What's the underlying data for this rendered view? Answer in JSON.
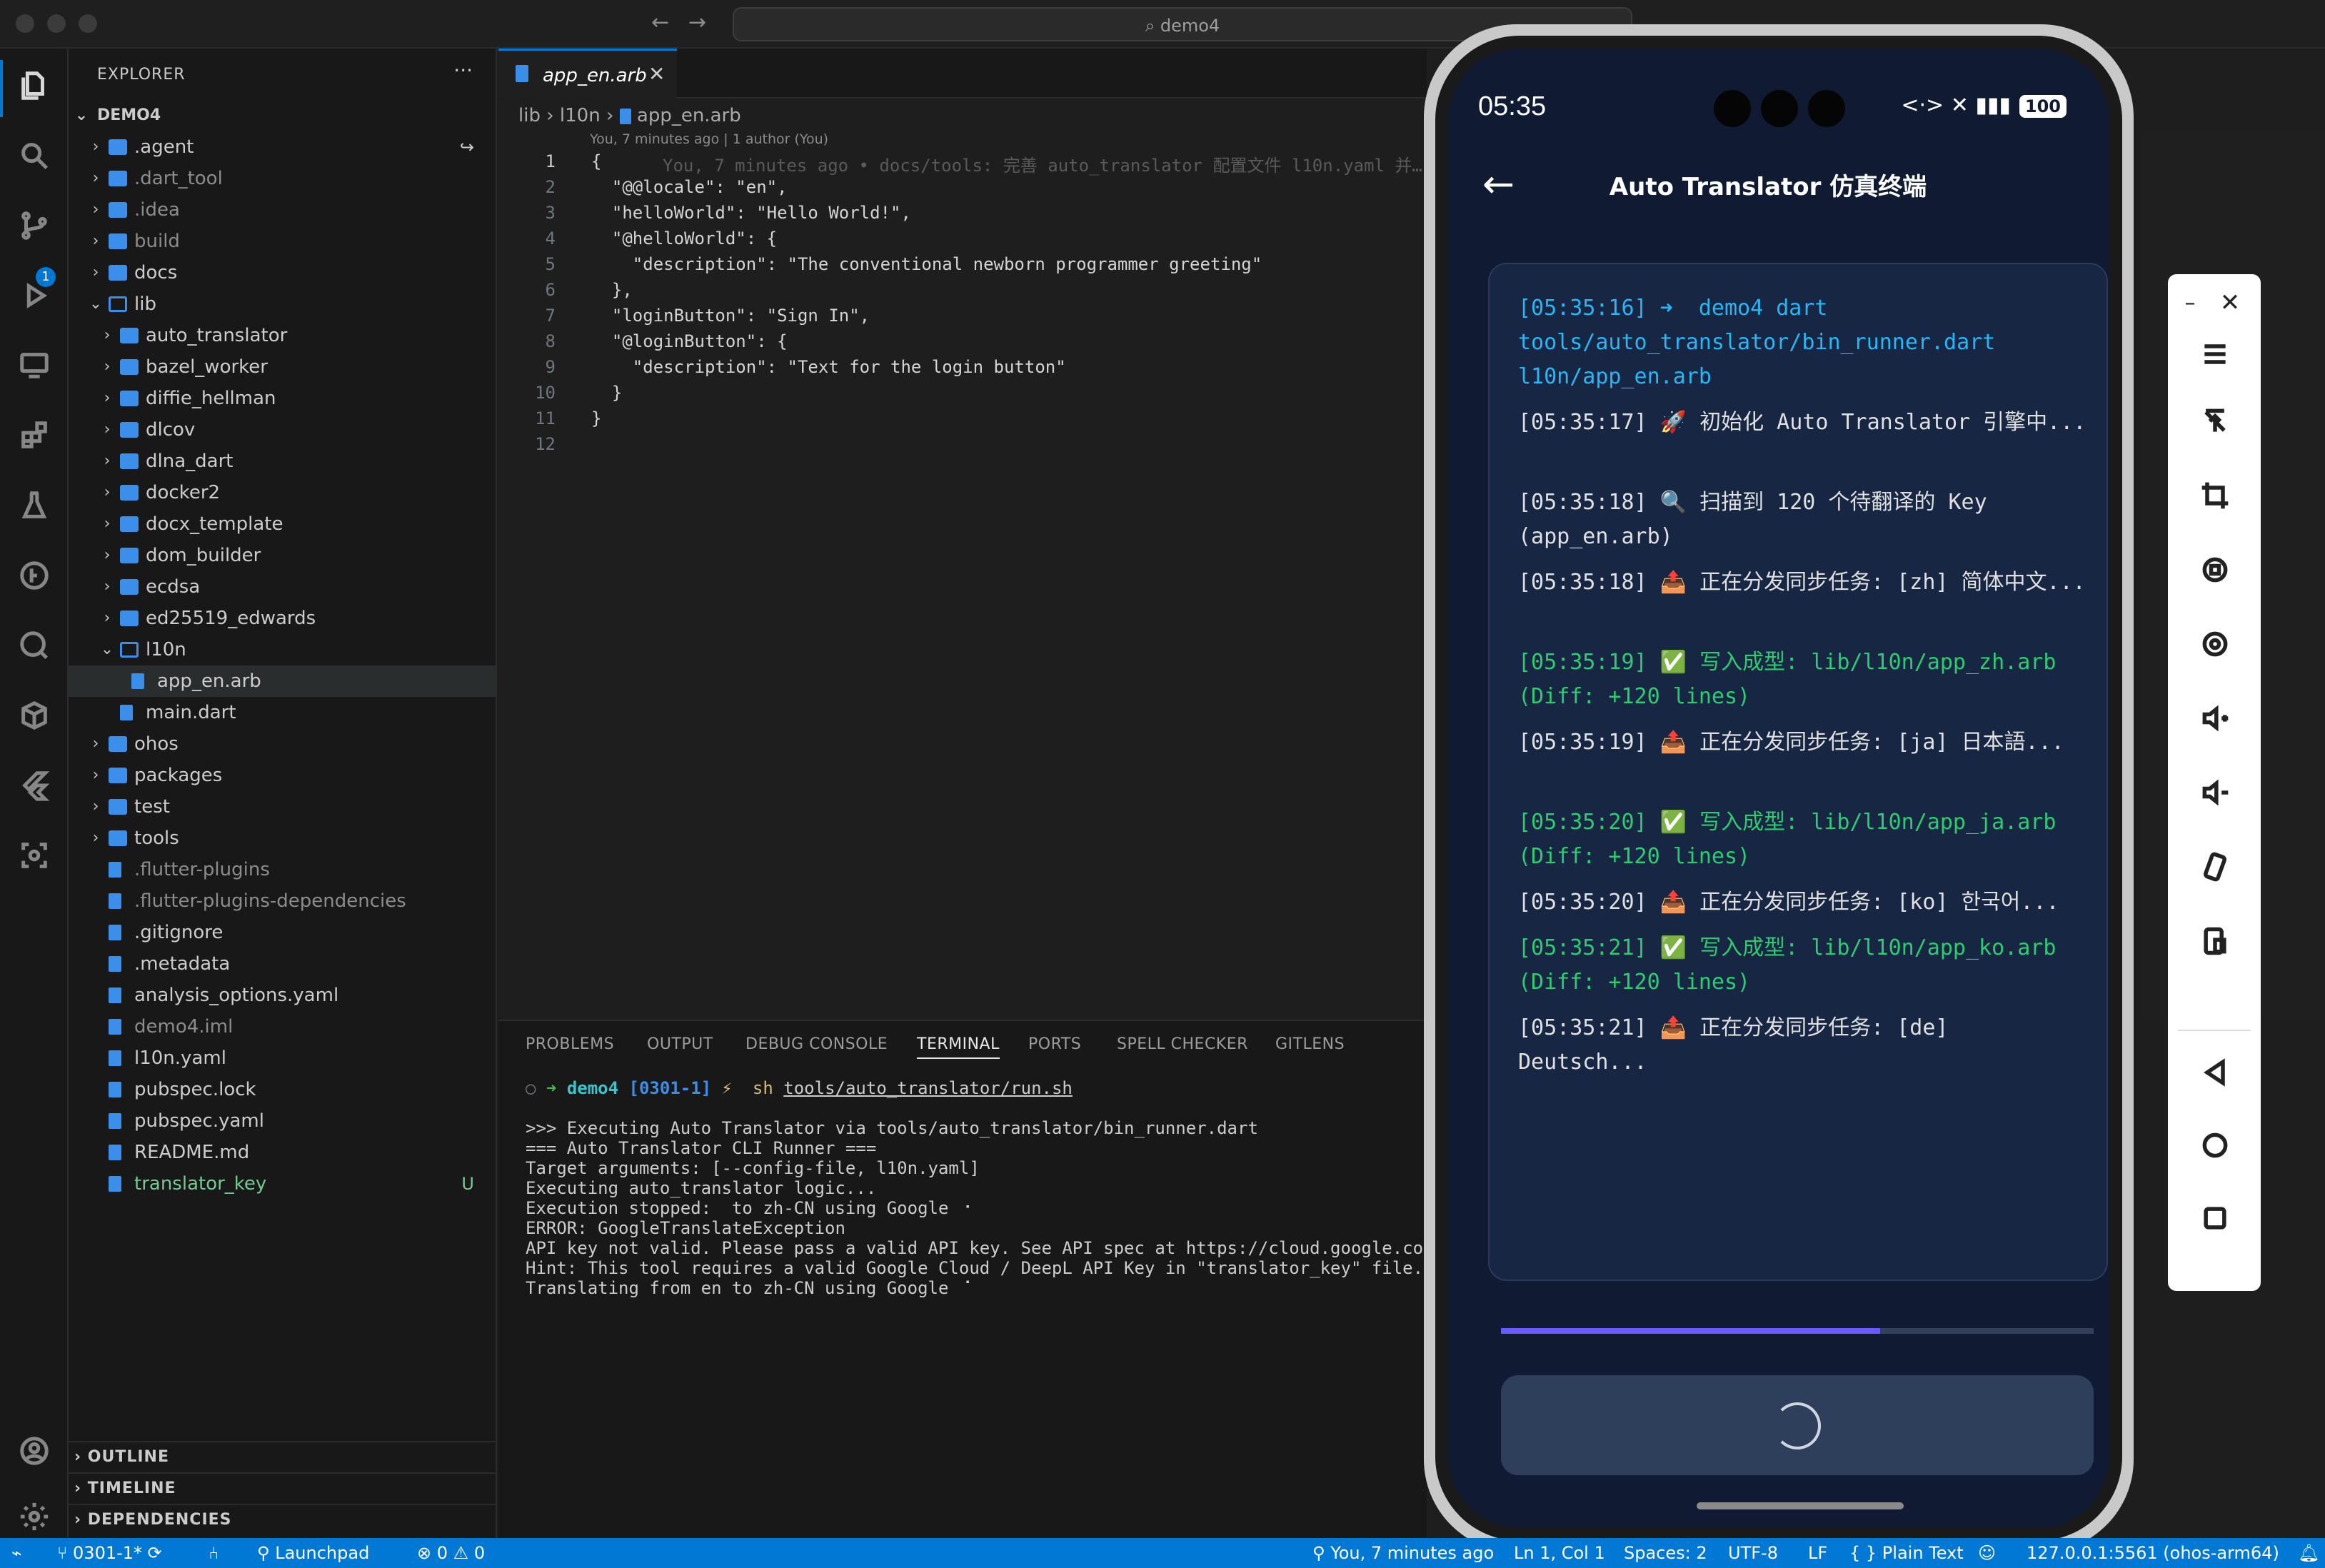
{
  "window": {
    "search": "demo4"
  },
  "activity": {
    "scm_badge": "1"
  },
  "explorer": {
    "title": "EXPLORER",
    "more": "···",
    "root": "DEMO4",
    "items": [
      {
        "label": ".agent",
        "kind": "folder",
        "depth": 0,
        "status": "↪"
      },
      {
        "label": ".dart_tool",
        "kind": "folder",
        "depth": 0,
        "dim": true
      },
      {
        "label": ".idea",
        "kind": "folder",
        "depth": 0,
        "dim": true
      },
      {
        "label": "build",
        "kind": "folder",
        "depth": 0,
        "dim": true
      },
      {
        "label": "docs",
        "kind": "folder",
        "depth": 0
      },
      {
        "label": "lib",
        "kind": "folder-open",
        "depth": 0
      },
      {
        "label": "auto_translator",
        "kind": "folder",
        "depth": 1
      },
      {
        "label": "bazel_worker",
        "kind": "folder",
        "depth": 1
      },
      {
        "label": "diffie_hellman",
        "kind": "folder",
        "depth": 1
      },
      {
        "label": "dlcov",
        "kind": "folder",
        "depth": 1
      },
      {
        "label": "dlna_dart",
        "kind": "folder",
        "depth": 1
      },
      {
        "label": "docker2",
        "kind": "folder",
        "depth": 1
      },
      {
        "label": "docx_template",
        "kind": "folder",
        "depth": 1
      },
      {
        "label": "dom_builder",
        "kind": "folder",
        "depth": 1
      },
      {
        "label": "ecdsa",
        "kind": "folder",
        "depth": 1
      },
      {
        "label": "ed25519_edwards",
        "kind": "folder",
        "depth": 1
      },
      {
        "label": "l10n",
        "kind": "folder-open",
        "depth": 1
      },
      {
        "label": "app_en.arb",
        "kind": "file",
        "depth": 2,
        "selected": true
      },
      {
        "label": "main.dart",
        "kind": "file",
        "depth": 1
      },
      {
        "label": "ohos",
        "kind": "folder",
        "depth": 0
      },
      {
        "label": "packages",
        "kind": "folder",
        "depth": 0
      },
      {
        "label": "test",
        "kind": "folder",
        "depth": 0
      },
      {
        "label": "tools",
        "kind": "folder",
        "depth": 0
      },
      {
        "label": ".flutter-plugins",
        "kind": "file",
        "depth": 0,
        "dim": true
      },
      {
        "label": ".flutter-plugins-dependencies",
        "kind": "file",
        "depth": 0,
        "dim": true
      },
      {
        "label": ".gitignore",
        "kind": "file",
        "depth": 0
      },
      {
        "label": ".metadata",
        "kind": "file",
        "depth": 0
      },
      {
        "label": "analysis_options.yaml",
        "kind": "file",
        "depth": 0
      },
      {
        "label": "demo4.iml",
        "kind": "file",
        "depth": 0,
        "dim": true
      },
      {
        "label": "l10n.yaml",
        "kind": "file",
        "depth": 0
      },
      {
        "label": "pubspec.lock",
        "kind": "file",
        "depth": 0
      },
      {
        "label": "pubspec.yaml",
        "kind": "file",
        "depth": 0
      },
      {
        "label": "README.md",
        "kind": "file",
        "depth": 0
      },
      {
        "label": "translator_key",
        "kind": "file",
        "depth": 0,
        "untracked": true,
        "status": "U"
      }
    ],
    "sections": [
      "OUTLINE",
      "TIMELINE",
      "DEPENDENCIES"
    ]
  },
  "editor": {
    "tab": "app_en.arb",
    "breadcrumb": [
      "lib",
      "l10n",
      "app_en.arb"
    ],
    "blame_header": "You, 7 minutes ago | 1 author (You)",
    "ghost_blame": "You, 7 minutes ago • docs/tools: 完善 auto_translator 配置文件 l10n.yaml 并…",
    "lines": [
      "{",
      "  \"@@locale\": \"en\",",
      "  \"helloWorld\": \"Hello World!\",",
      "  \"@helloWorld\": {",
      "    \"description\": \"The conventional newborn programmer greeting\"",
      "  },",
      "  \"loginButton\": \"Sign In\",",
      "  \"@loginButton\": {",
      "    \"description\": \"Text for the login button\"",
      "  }",
      "}",
      ""
    ]
  },
  "panel": {
    "tabs": [
      "PROBLEMS",
      "OUTPUT",
      "DEBUG CONSOLE",
      "TERMINAL",
      "PORTS",
      "SPELL CHECKER",
      "GITLENS"
    ],
    "active_tab": "TERMINAL",
    "prompt_dir": "demo4",
    "prompt_branch": "[0301-1]",
    "prompt_flag": "⚡",
    "command_bin": "sh",
    "command_arg": "tools/auto_translator/run.sh",
    "output": [
      ">>> Executing Auto Translator via tools/auto_translator/bin_runner.dart",
      "=== Auto Translator CLI Runner ===",
      "Target arguments: [--config-file, l10n.yaml]",
      "Executing auto_translator logic...",
      "Execution stopped:  to zh-CN using Google ⠐",
      "ERROR: GoogleTranslateException",
      "API key not valid. Please pass a valid API key. See API spec at https://cloud.google.com/t",
      "Hint: This tool requires a valid Google Cloud / DeepL API Key in \"translator_key\" file.",
      "Translating from en to zh-CN using Google ⠈"
    ]
  },
  "phone": {
    "time": "05:35",
    "signal": "<·> ✕ ▮▮▮",
    "battery": "100",
    "back": "←",
    "title": "Auto Translator 仿真终端",
    "logs": [
      {
        "text": "[05:35:16] ➜  demo4 dart tools/auto_translator/bin_runner.dart l10n/app_en.arb",
        "tone": "cyan"
      },
      {
        "text": "[05:35:17] 🚀 初始化 Auto Translator 引擎中...",
        "tone": "white"
      },
      {
        "text": "[05:35:18] 🔍 扫描到 120 个待翻译的 Key (app_en.arb)",
        "tone": "white"
      },
      {
        "text": "[05:35:18] 📤 正在分发同步任务: [zh] 简体中文...",
        "tone": "white"
      },
      {
        "text": "[05:35:19] ✅ 写入成型: lib/l10n/app_zh.arb (Diff: +120 lines)",
        "tone": "green"
      },
      {
        "text": "[05:35:19] 📤 正在分发同步任务: [ja] 日本語...",
        "tone": "white"
      },
      {
        "text": "[05:35:20] ✅ 写入成型: lib/l10n/app_ja.arb (Diff: +120 lines)",
        "tone": "green"
      },
      {
        "text": "[05:35:20] 📤 正在分发同步任务: [ko] 한국어...",
        "tone": "white"
      },
      {
        "text": "[05:35:21] ✅ 写入成型: lib/l10n/app_ko.arb (Diff: +120 lines)",
        "tone": "green"
      },
      {
        "text": "[05:35:21] 📤 正在分发同步任务: [de] Deutsch...",
        "tone": "white"
      }
    ],
    "progress": 0.64
  },
  "statusbar": {
    "branch": "0301-1*",
    "launchpad": "Launchpad",
    "errors": "0",
    "warnings": "0",
    "blame": "You, 7 minutes ago",
    "position": "Ln 1, Col 1",
    "spaces": "Spaces: 2",
    "encoding": "UTF-8",
    "eol": "LF",
    "language": "Plain Text",
    "device": "127.0.0.1:5561 (ohos-arm64)"
  },
  "colors": {
    "accent": "#0078d4",
    "phone_bg": "#101b33",
    "log_cyan": "#29b6f6",
    "log_green": "#2ecc71",
    "progress": "#6b5bff"
  }
}
